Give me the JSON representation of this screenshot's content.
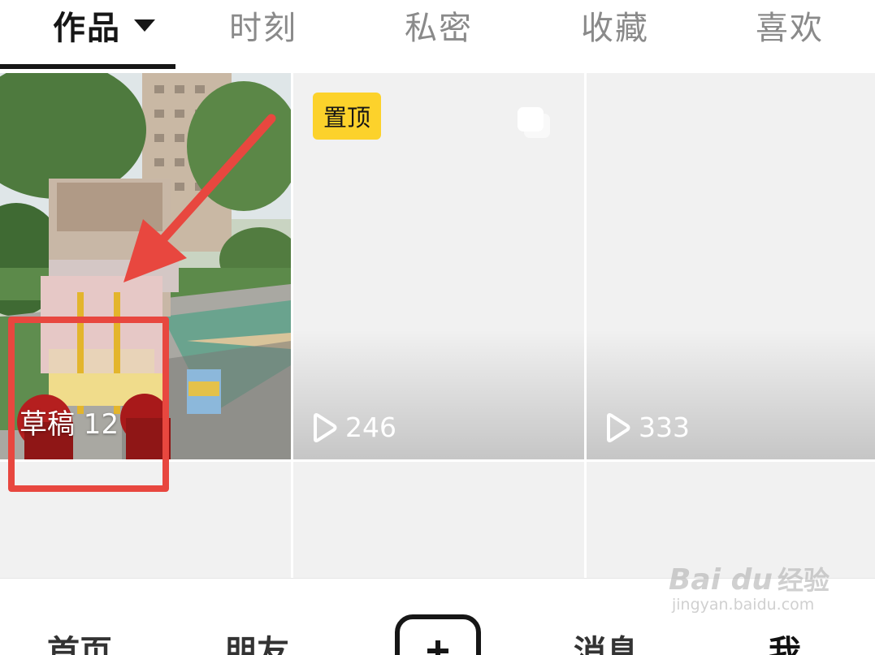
{
  "tabs": [
    {
      "label": "作品",
      "active": true
    },
    {
      "label": "时刻",
      "active": false
    },
    {
      "label": "私密",
      "active": false
    },
    {
      "label": "收藏",
      "active": false
    },
    {
      "label": "喜欢",
      "active": false
    }
  ],
  "grid": {
    "draft": {
      "label": "草稿 12"
    },
    "videos": [
      {
        "badge": "置顶",
        "play_count": "246",
        "icon": "multi-image-icon"
      },
      {
        "play_count": "333"
      }
    ]
  },
  "bottom_nav": {
    "items": [
      {
        "label": "首页"
      },
      {
        "label": "朋友"
      },
      {
        "label": "消息"
      },
      {
        "label": "我"
      }
    ],
    "create_icon": "plus-icon"
  },
  "watermark": {
    "logo": "Bai du",
    "name": "经验",
    "url": "jingyan.baidu.com"
  },
  "colors": {
    "accent_badge": "#fcd22b",
    "annotation": "#e8473f",
    "text_active": "#161616",
    "text_inactive": "#8a8a8a"
  }
}
